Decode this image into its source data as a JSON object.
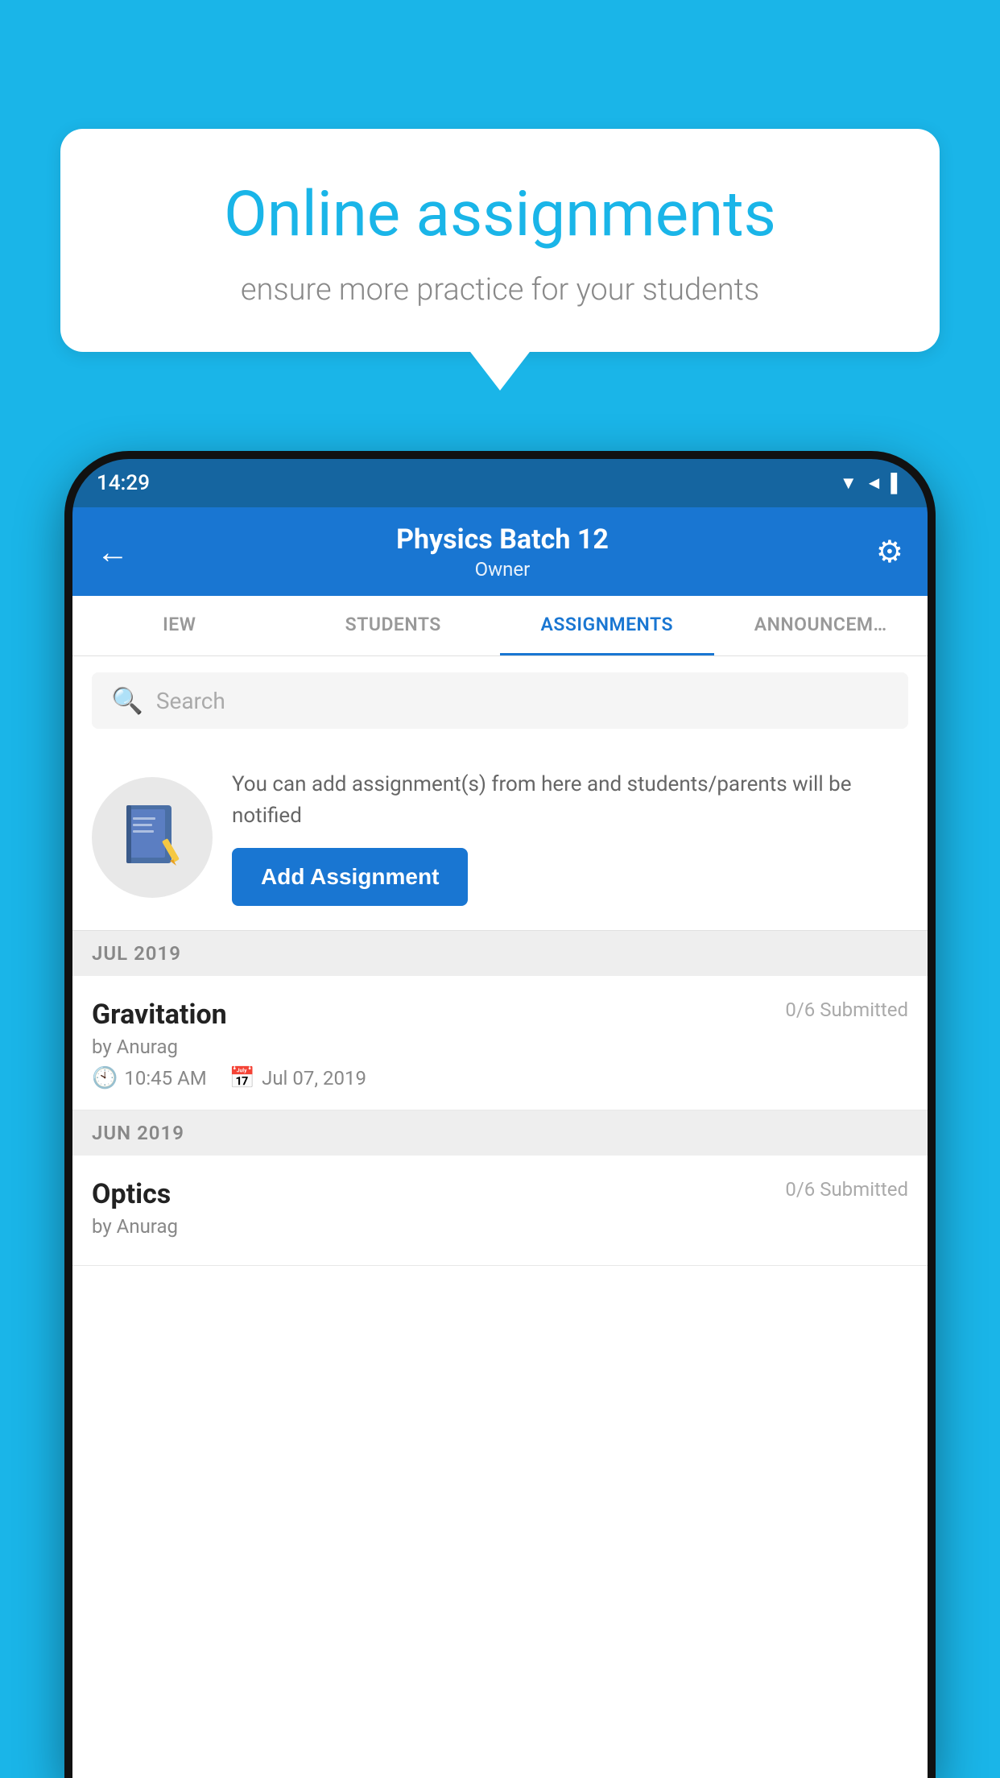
{
  "background_color": "#1ab5e8",
  "speech_bubble": {
    "title": "Online assignments",
    "subtitle": "ensure more practice for your students"
  },
  "phone": {
    "status_bar": {
      "time": "14:29",
      "icons": "▼◄▌"
    },
    "header": {
      "title": "Physics Batch 12",
      "subtitle": "Owner",
      "back_label": "←",
      "gear_label": "⚙"
    },
    "tabs": [
      {
        "label": "IEW",
        "active": false
      },
      {
        "label": "STUDENTS",
        "active": false
      },
      {
        "label": "ASSIGNMENTS",
        "active": true
      },
      {
        "label": "ANNOUNCEM…",
        "active": false
      }
    ],
    "search": {
      "placeholder": "Search"
    },
    "promo": {
      "description": "You can add assignment(s) from here and students/parents will be notified",
      "button_label": "Add Assignment"
    },
    "assignments": {
      "sections": [
        {
          "month": "JUL 2019",
          "items": [
            {
              "name": "Gravitation",
              "submitted": "0/6 Submitted",
              "by": "by Anurag",
              "time": "10:45 AM",
              "date": "Jul 07, 2019"
            }
          ]
        },
        {
          "month": "JUN 2019",
          "items": [
            {
              "name": "Optics",
              "submitted": "0/6 Submitted",
              "by": "by Anurag",
              "time": "",
              "date": ""
            }
          ]
        }
      ]
    }
  }
}
